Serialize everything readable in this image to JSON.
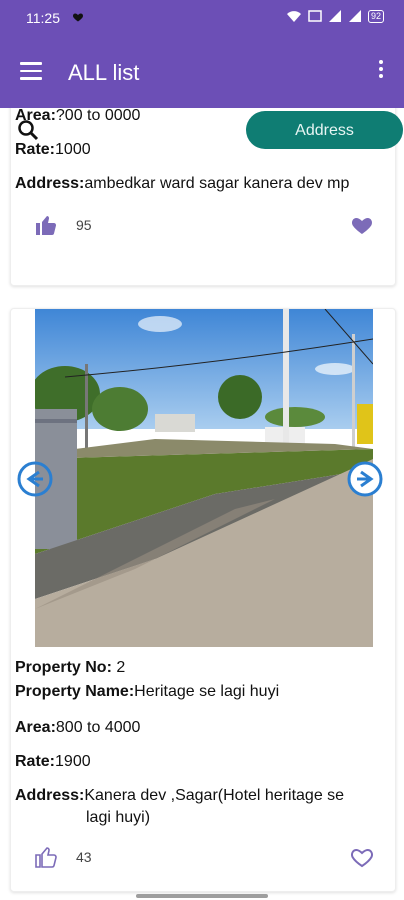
{
  "status_bar": {
    "time": "11:25",
    "battery": "92"
  },
  "app_bar": {
    "title": "ALL list"
  },
  "search": {
    "button_label": "Address"
  },
  "cards": [
    {
      "area_label": "Area:",
      "area_value": "?00 to 0000",
      "rate_label": "Rate:",
      "rate_value": "1000",
      "address_label": "Address:",
      "address_value": "ambedkar ward sagar kanera dev mp",
      "likes": "95"
    },
    {
      "property_no_label": "Property No:",
      "property_no_value": " 2",
      "property_name_label": "Property Name:",
      "property_name_value": "Heritage se lagi huyi",
      "area_label": "Area:",
      "area_value": "800 to 4000",
      "rate_label": "Rate:",
      "rate_value": "1900",
      "address_label": "Address:",
      "address_value_line1": "Kanera dev ,Sagar(Hotel  heritage se",
      "address_value_line2": "lagi huyi)",
      "likes": "43"
    }
  ],
  "colors": {
    "primary": "#6c4fb6",
    "accent": "#0f7d73",
    "icon_purple": "#7c6bb8"
  }
}
